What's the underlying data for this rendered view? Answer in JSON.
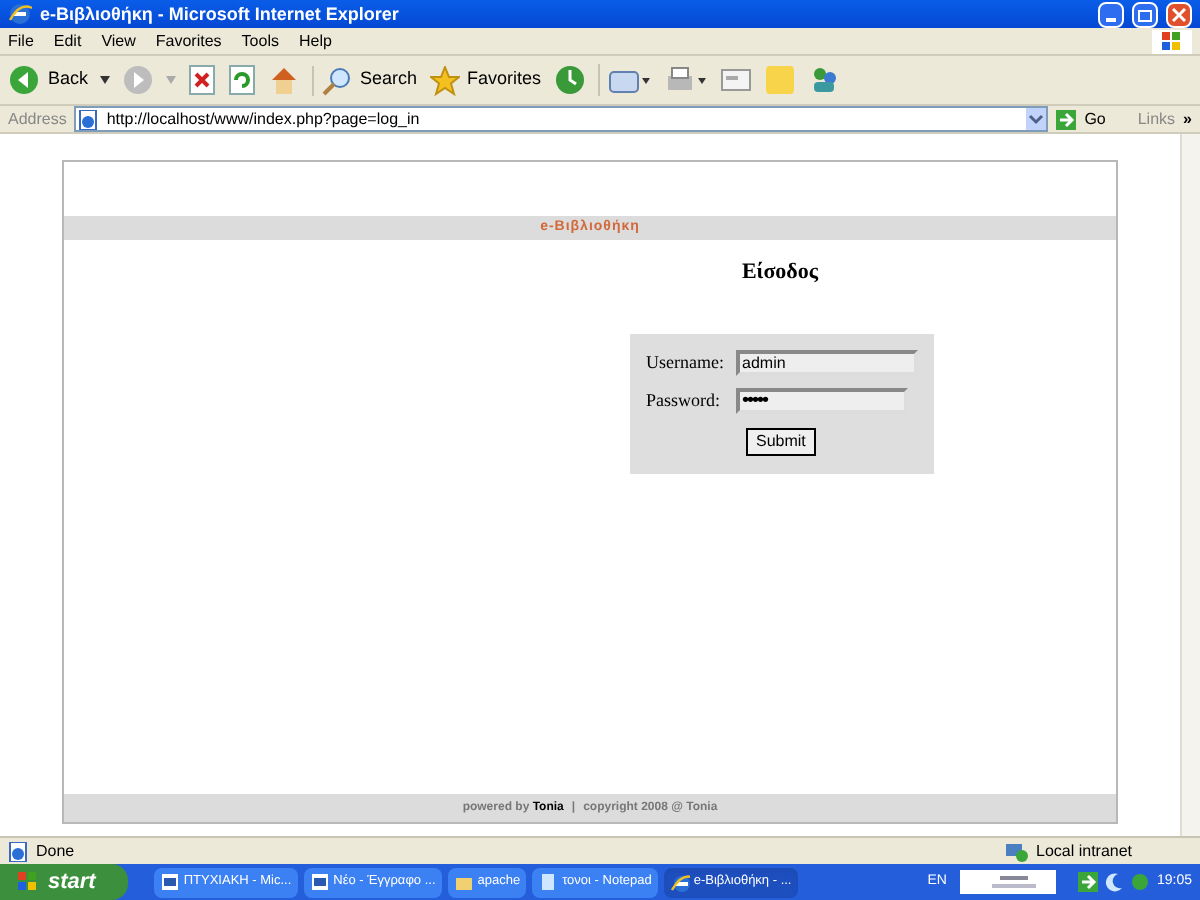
{
  "window": {
    "title": "e-Βιβλιοθήκη - Microsoft Internet Explorer"
  },
  "menu": [
    "File",
    "Edit",
    "View",
    "Favorites",
    "Tools",
    "Help"
  ],
  "toolbar": {
    "back": "Back",
    "search": "Search",
    "favorites": "Favorites"
  },
  "address_bar": {
    "label": "Address",
    "url": "http://localhost/www/index.php?page=log_in",
    "go": "Go",
    "links": "Links",
    "more": "»"
  },
  "page": {
    "site_title": "e-Βιβλιοθήκη",
    "heading": "Είσοδος",
    "form": {
      "fields": [
        {
          "label": "Username:",
          "kind": "text",
          "value": "admin"
        },
        {
          "label": "Password:",
          "kind": "password",
          "value": "•••••"
        }
      ],
      "submit": "Submit"
    },
    "footer": {
      "powered_by": "powered by",
      "author": "Tonia",
      "separator": "|",
      "copyright": "copyright 2008 @ Tonia"
    }
  },
  "status_bar": {
    "status": "Done",
    "zone": "Local intranet"
  },
  "taskbar": {
    "start": "start",
    "items": [
      {
        "label": "ΠΤΥΧΙΑΚΗ - Mic...",
        "kind": "doc",
        "selected": false
      },
      {
        "label": "Νέο - Έγγραφο ...",
        "kind": "doc",
        "selected": false
      },
      {
        "label": "apache",
        "kind": "folder",
        "selected": false
      },
      {
        "label": "τονοι - Notepad",
        "kind": "notepad",
        "selected": false
      },
      {
        "label": "e-Βιβλιοθήκη - ...",
        "kind": "ie",
        "selected": true
      }
    ],
    "language": "EN",
    "clock": "19:05"
  }
}
